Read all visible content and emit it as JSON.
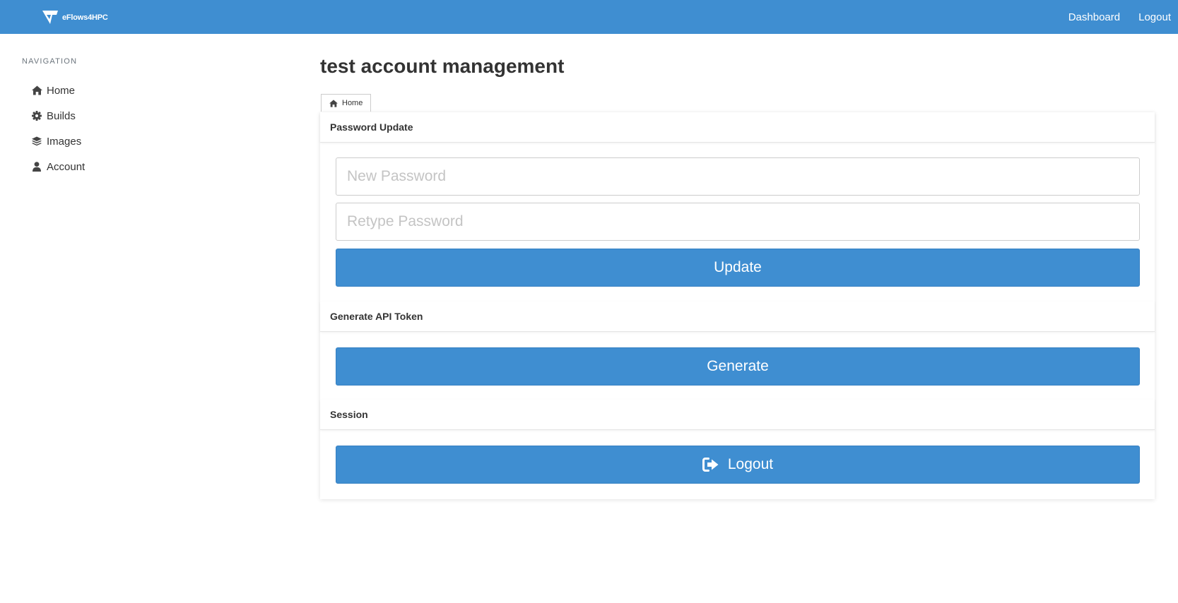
{
  "brand": {
    "name": "eFlows4HPC"
  },
  "topnav": {
    "dashboard": "Dashboard",
    "logout": "Logout"
  },
  "sidebar": {
    "heading": "NAVIGATION",
    "items": [
      {
        "label": "Home",
        "icon": "home-icon"
      },
      {
        "label": "Builds",
        "icon": "gear-icon"
      },
      {
        "label": "Images",
        "icon": "layers-icon"
      },
      {
        "label": "Account",
        "icon": "user-icon"
      }
    ]
  },
  "main": {
    "title": "test account management",
    "breadcrumb": {
      "label": "Home",
      "icon": "home-icon"
    },
    "password_section": {
      "heading": "Password Update",
      "new_password_placeholder": "New Password",
      "retype_password_placeholder": "Retype Password",
      "update_label": "Update"
    },
    "token_section": {
      "heading": "Generate API Token",
      "generate_label": "Generate"
    },
    "session_section": {
      "heading": "Session",
      "logout_label": "Logout",
      "logout_icon": "sign-out-icon"
    }
  },
  "colors": {
    "accent": "#3f8ed1",
    "text": "#333333"
  }
}
